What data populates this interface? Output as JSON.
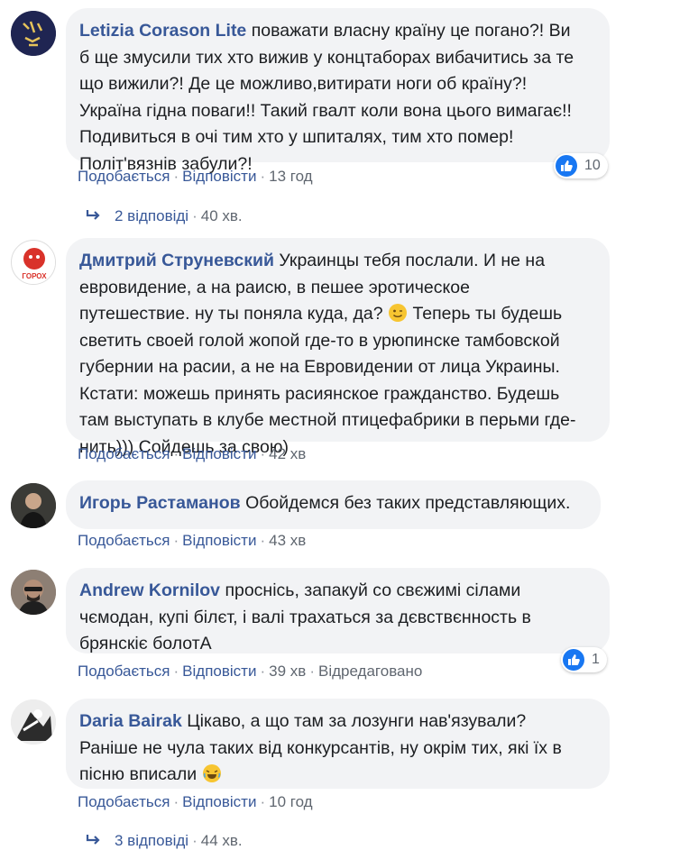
{
  "actions": {
    "like": "Подобається",
    "reply": "Відповісти",
    "dot": "·"
  },
  "comments": [
    {
      "author": "Letizia Corason Lite",
      "lines": [
        "поважати власну країну це погано?! Ви",
        "б ще змусили тих хто вижив у концтаборах вибачитись за те",
        "що вижили?! Де це можливо,витирати ноги об країну?!",
        "Україна гідна поваги!! Такий гвалт коли вона цього вимагає!!",
        "Подивиться в очі тим хто у шпиталях, тим хто помер!",
        "Політ'вязнів забули?!"
      ],
      "time": "13 год",
      "reactions": "10",
      "replies": {
        "label": "2 відповіді",
        "time": "40 хв."
      }
    },
    {
      "author": "Дмитрий Струневский",
      "lines": [
        "Украинцы тебя послали. И не на",
        "евровидение, а на раисю, в пешее эротическое",
        "путешествие. ну ты поняла куда, да? ",
        "светить своей голой жопой где-то в урюпинске тамбовской",
        "губернии на расии, а не на Евровидении от лица Украины.",
        "Кстати: можешь принять расиянское гражданство. Будешь",
        "там выступать в клубе местной птицефабрики в перьми где-",
        "нить))) Сойдешь за свою)"
      ],
      "line3_tail": " Теперь ты будешь",
      "time": "42 хв",
      "avatar_text": "ГОРОХ"
    },
    {
      "author": "Игорь Растаманов",
      "lines": [
        "Обойдемся без таких представляющих."
      ],
      "time": "43 хв"
    },
    {
      "author": "Andrew Kornilov",
      "lines": [
        "проснісь, запакуй со свєжимі сілами",
        "чємодан, купі білєт, і валі трахаться за дєвствєнность в",
        "брянскіє болотА"
      ],
      "time": "39 хв",
      "edited": "Відредаговано",
      "reactions": "1"
    },
    {
      "author": "Daria Bairak",
      "lines": [
        "Цікаво, а що там за лозунги нав'язували?",
        "Раніше не чула таких від конкурсантів, ну окрім тих, які їх в",
        "пісню вписали "
      ],
      "time": "10 год",
      "replies": {
        "label": "3 відповіді",
        "time": "44 хв."
      }
    }
  ],
  "colors": {
    "link": "#385898",
    "bubble": "#f2f3f5",
    "like": "#1877f2",
    "meta": "#606770"
  }
}
